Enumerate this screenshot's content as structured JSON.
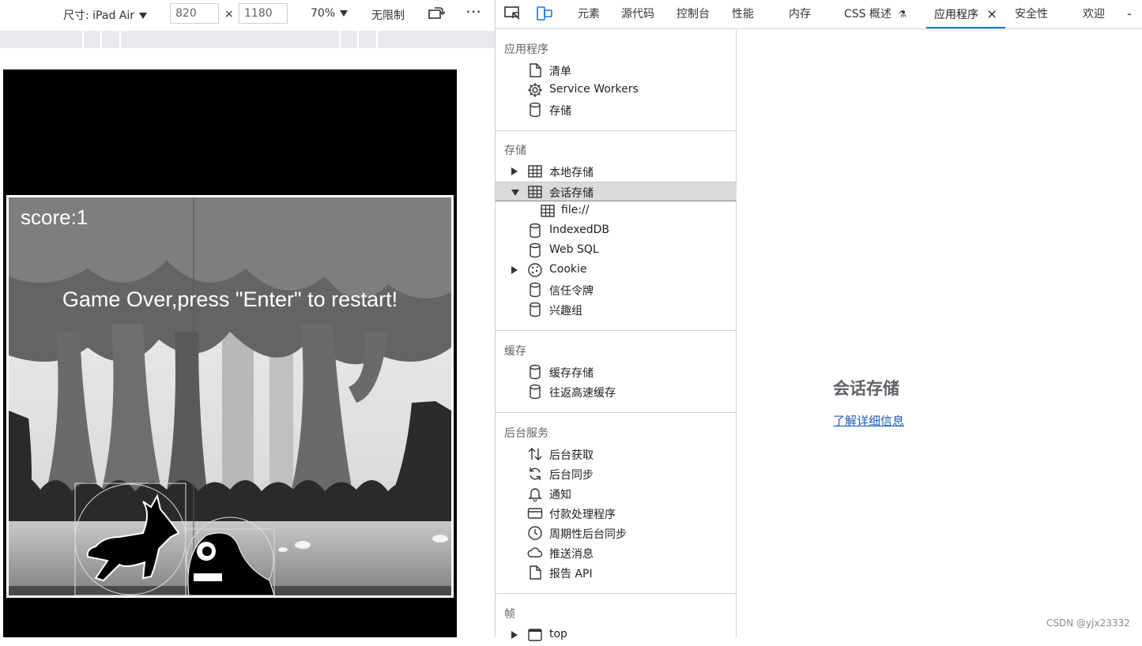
{
  "emulation_toolbar": {
    "dimensions_label": "尺寸: iPad Air",
    "width": "820",
    "times": "×",
    "height": "1180",
    "zoom": "70%",
    "throttle": "无限制",
    "rotate_icon": "rotate-icon",
    "more_icon": "more-dots-icon"
  },
  "game": {
    "score": "score:1",
    "message": "Game Over,press \"Enter\" to restart!"
  },
  "devtools": {
    "tabs": [
      {
        "label": "元素"
      },
      {
        "label": "源代码"
      },
      {
        "label": "控制台"
      },
      {
        "label": "性能"
      },
      {
        "label": "内存"
      },
      {
        "label": "CSS 概述"
      },
      {
        "label": "应用程序",
        "active": true
      },
      {
        "label": "安全性"
      },
      {
        "label": "欢迎"
      }
    ],
    "close_tab_glyph": "×",
    "sidebar": {
      "sections": [
        {
          "title": "应用程序",
          "items": [
            {
              "label": "清单",
              "icon": "file-icon"
            },
            {
              "label": "Service Workers",
              "icon": "gear-icon"
            },
            {
              "label": "存储",
              "icon": "database-icon"
            }
          ]
        },
        {
          "title": "存储",
          "items": [
            {
              "label": "本地存储",
              "icon": "table-icon",
              "expand": "collapsed"
            },
            {
              "label": "会话存储",
              "icon": "table-icon",
              "expand": "expanded",
              "selected": true
            },
            {
              "label": "file://",
              "icon": "table-icon",
              "child": true
            },
            {
              "label": "IndexedDB",
              "icon": "database-icon"
            },
            {
              "label": "Web SQL",
              "icon": "database-icon"
            },
            {
              "label": "Cookie",
              "icon": "cookie-icon",
              "expand": "collapsed"
            },
            {
              "label": "信任令牌",
              "icon": "database-icon"
            },
            {
              "label": "兴趣组",
              "icon": "database-icon"
            }
          ]
        },
        {
          "title": "缓存",
          "items": [
            {
              "label": "缓存存储",
              "icon": "database-icon"
            },
            {
              "label": "往返高速缓存",
              "icon": "database-icon"
            }
          ]
        },
        {
          "title": "后台服务",
          "items": [
            {
              "label": "后台获取",
              "icon": "arrows-updown-icon"
            },
            {
              "label": "后台同步",
              "icon": "sync-icon"
            },
            {
              "label": "通知",
              "icon": "bell-icon"
            },
            {
              "label": "付款处理程序",
              "icon": "card-icon"
            },
            {
              "label": "周期性后台同步",
              "icon": "clock-icon"
            },
            {
              "label": "推送消息",
              "icon": "cloud-icon"
            },
            {
              "label": "报告 API",
              "icon": "file-icon"
            }
          ]
        },
        {
          "title": "帧",
          "items": [
            {
              "label": "top",
              "icon": "frame-icon",
              "expand": "collapsed"
            }
          ]
        }
      ]
    },
    "main": {
      "title": "会话存储",
      "link": "了解详细信息"
    }
  },
  "watermark": "CSDN @yjx23332"
}
